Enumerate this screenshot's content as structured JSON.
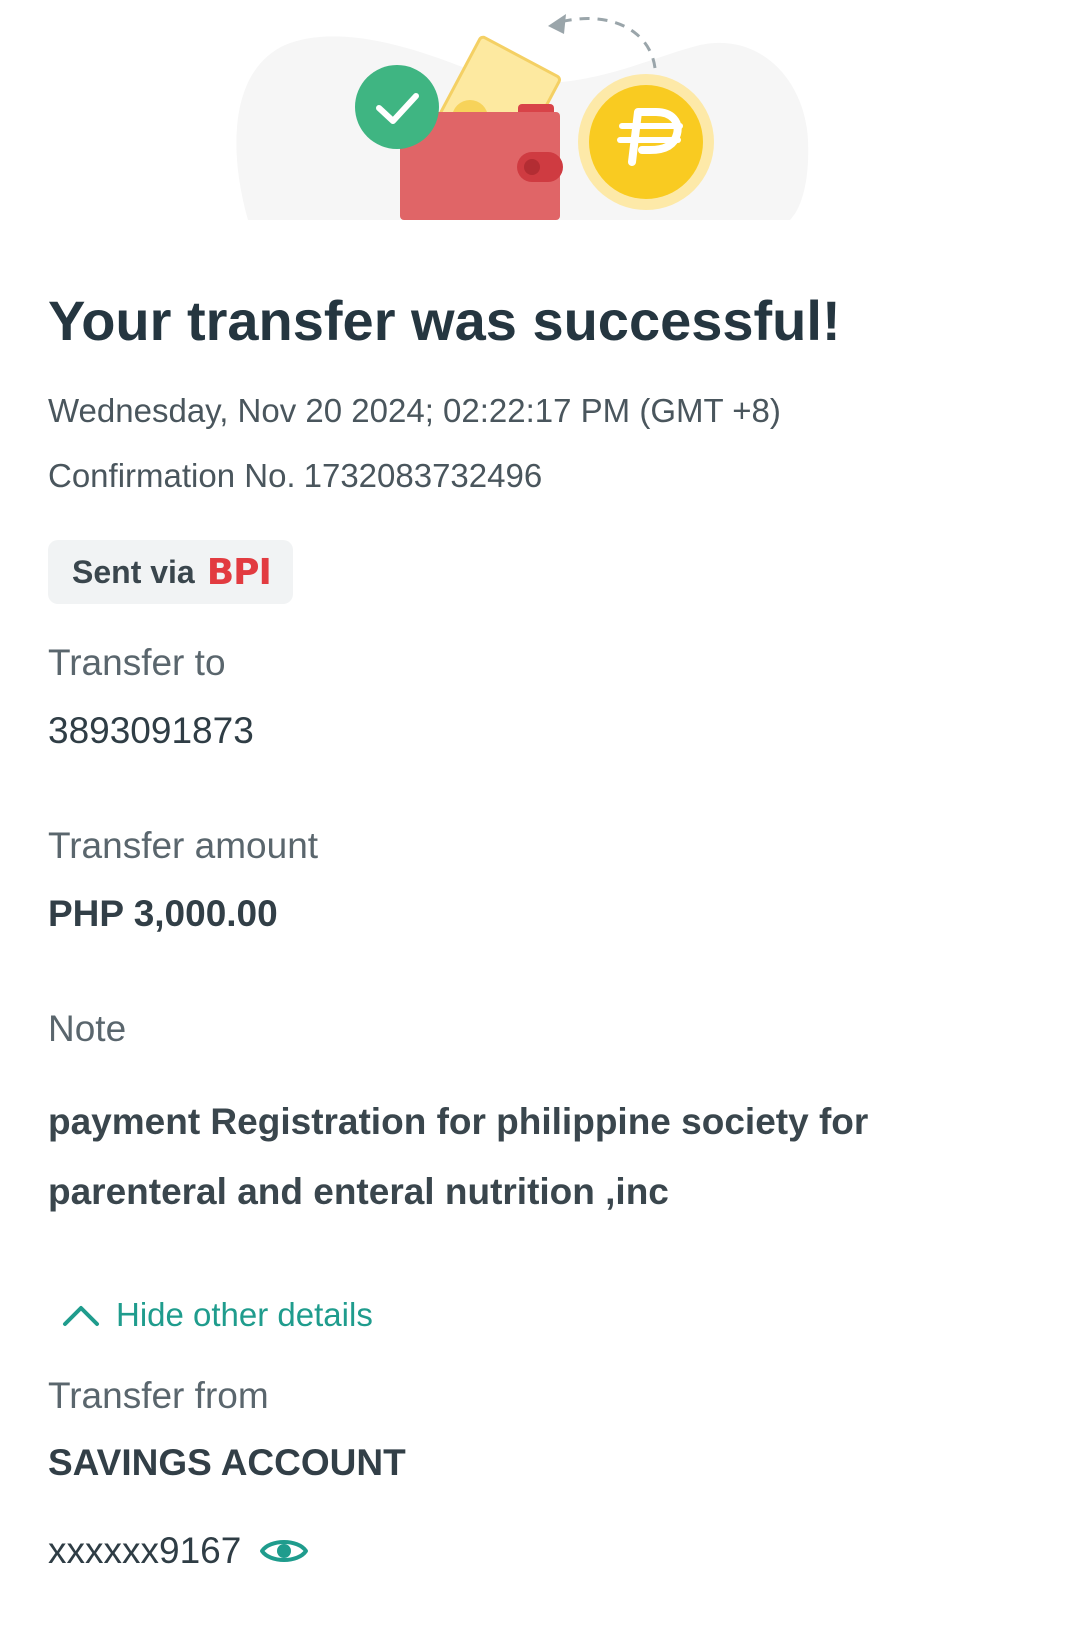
{
  "header": {
    "title": "Your transfer was successful!",
    "datetime": "Wednesday, Nov 20 2024; 02:22:17 PM (GMT +8)",
    "confirmation_label": "Confirmation No.",
    "confirmation_number": "1732083732496",
    "illustration_icons": [
      "check-icon",
      "wallet-icon",
      "peso-coin-icon",
      "arrow-icon"
    ]
  },
  "sent_via": {
    "label": "Sent via",
    "brand": "BPI"
  },
  "details": {
    "transfer_to_label": "Transfer to",
    "transfer_to_value": "3893091873",
    "amount_label": "Transfer amount",
    "amount_value": "PHP 3,000.00",
    "note_label": "Note",
    "note_value": "payment Registration for philippine society for parenteral and enteral nutrition ,inc"
  },
  "toggle": {
    "label": "Hide other details",
    "icon": "chevron-up-icon"
  },
  "transfer_from": {
    "label": "Transfer from",
    "account_type": "SAVINGS ACCOUNT",
    "account_number": "xxxxxx9167",
    "reveal_icon": "eye-icon"
  },
  "colors": {
    "accent": "#1f9c8d",
    "brand_red": "#e23b40",
    "success_green": "#3fb582",
    "coin_yellow": "#f9cb21",
    "wallet_red": "#e06567"
  }
}
